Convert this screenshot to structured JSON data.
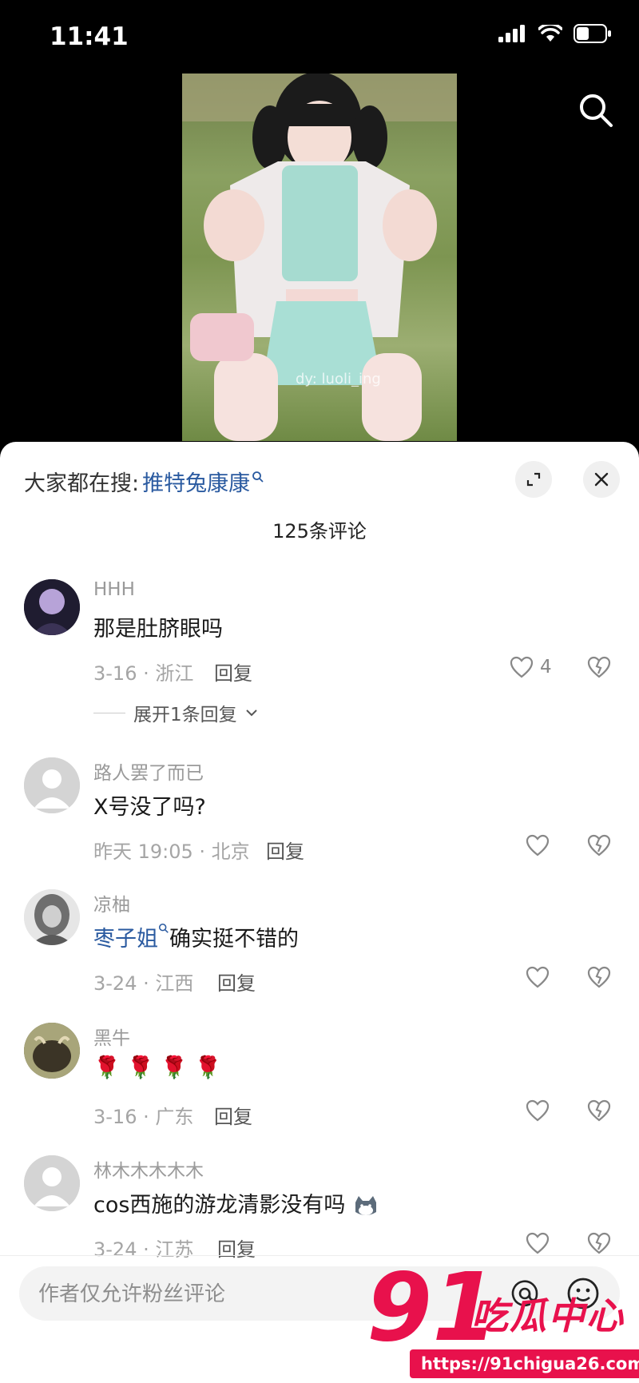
{
  "status": {
    "time": "11:41"
  },
  "video": {
    "watermark": "dy: luoli_ing"
  },
  "sheet": {
    "suggest_label": "大家都在搜:",
    "suggest_query": "推特兔康康",
    "comment_count": "125条评论"
  },
  "comments": [
    {
      "name": "HHH",
      "text": "那是肚脐眼吗",
      "meta": "3-16 · 浙江",
      "reply": "回复",
      "likes": "4",
      "expand": "展开1条回复"
    },
    {
      "name": "路人罢了而已",
      "text": "X号没了吗?",
      "meta": "昨天 19:05 · 北京",
      "reply": "回复"
    },
    {
      "name": "凉柚",
      "mention": "枣子姐",
      "text": "确实挺不错的",
      "meta": "3-24 · 江西",
      "reply": "回复"
    },
    {
      "name": "黑牛",
      "text": "🌹 🌹 🌹 🌹",
      "meta": "3-16 · 广东",
      "reply": "回复"
    },
    {
      "name": "林木木木木木",
      "text": "cos西施的游龙清影没有吗",
      "meta": "3-24 · 江苏",
      "reply": "回复"
    }
  ],
  "input": {
    "placeholder": "作者仅允许粉丝评论"
  },
  "overlay": {
    "big": "91",
    "text": "吃瓜中心",
    "url": "https://91chigua26.com"
  },
  "icons": {
    "search": "search-icon",
    "expand": "expand-icon",
    "close": "close-icon",
    "like": "heart-icon",
    "dislike": "broken-heart-icon",
    "at": "at-icon",
    "emoji": "emoji-icon"
  },
  "colors": {
    "link": "#2a5aa0",
    "watermark": "#e8114c"
  }
}
